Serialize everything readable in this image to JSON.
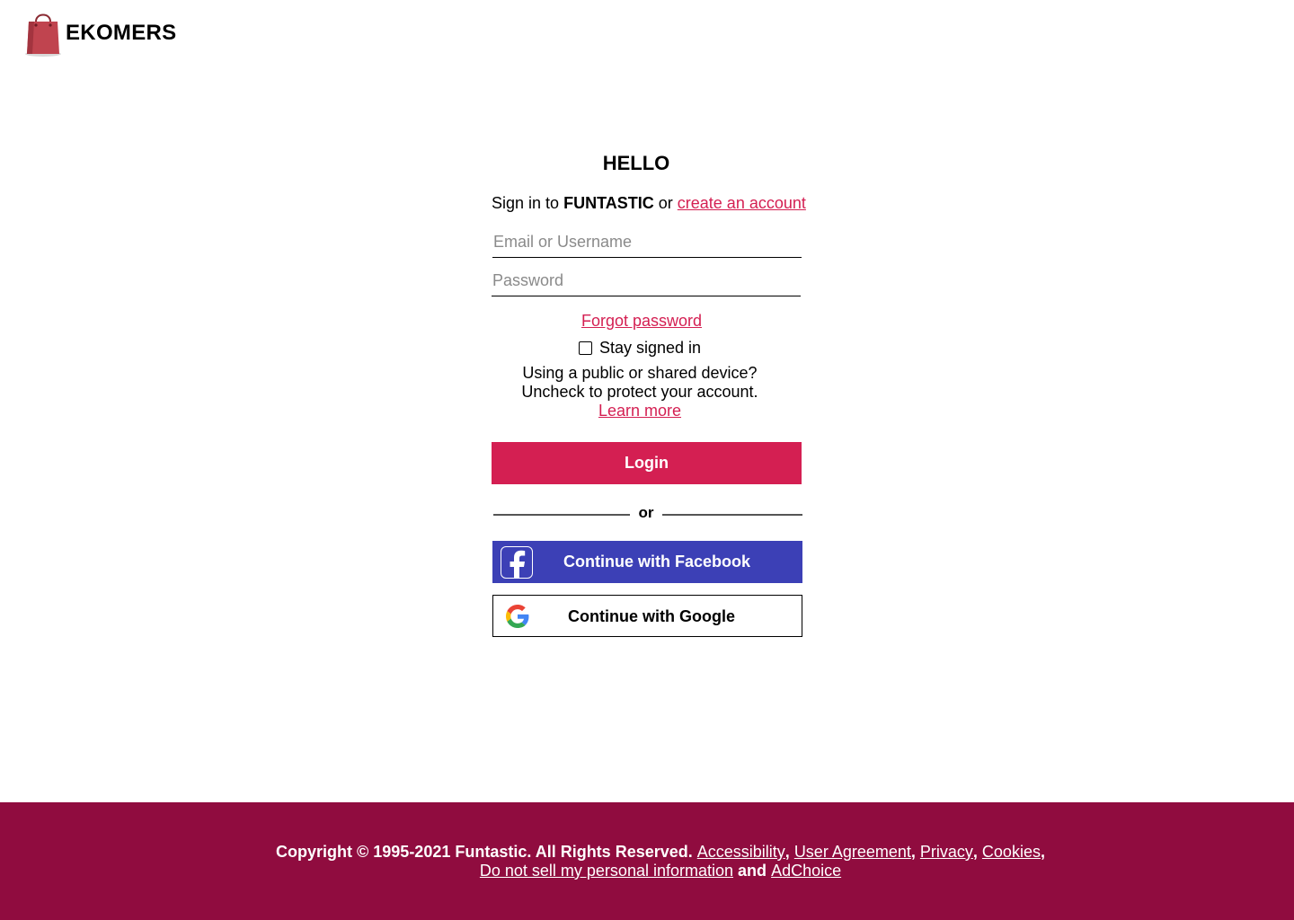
{
  "brand": {
    "name": "EKOMERS",
    "icon": "shopping-bag-icon",
    "icon_color": "#c0444f"
  },
  "heading": "HELLO",
  "signin": {
    "prefix": "Sign in to",
    "site": "FUNTASTIC",
    "conjunction": "or",
    "create_link": "create an account"
  },
  "form": {
    "email_placeholder": "Email or Username",
    "password_placeholder": "Password",
    "forgot_link": "Forgot password",
    "stay_signed_in_label": "Stay signed in",
    "stay_signed_in_checked": false,
    "notice_line1": "Using a public or shared device?",
    "notice_line2": "Uncheck to protect your account.",
    "learn_more_link": "Learn more",
    "login_label": "Login",
    "divider_text": "or"
  },
  "social": {
    "facebook_label": "Continue with Facebook",
    "facebook_icon": "facebook-icon",
    "google_label": "Continue with Google",
    "google_icon": "google-icon"
  },
  "footer": {
    "copyright": "Copyright © 1995-2021 Funtastic. All Rights Reserved.",
    "links": {
      "accessibility": "Accessibility",
      "user_agreement": "User Agreement",
      "privacy": "Privacy",
      "cookies": "Cookies",
      "do_not_sell": "Do not sell my personal information",
      "adchoice": "AdChoice"
    },
    "and": "and"
  },
  "colors": {
    "accent": "#d41f52",
    "facebook": "#3c40b6",
    "footer_bg": "#900c3f"
  }
}
